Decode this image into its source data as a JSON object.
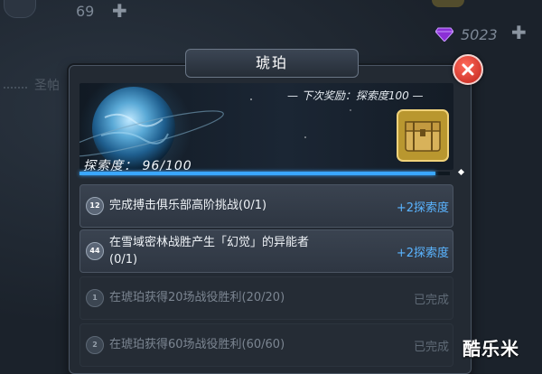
{
  "hud": {
    "left_count": "69",
    "gem_count": "5023",
    "plus_symbol": "✚"
  },
  "background_label": "圣帕",
  "dialog": {
    "title": "琥珀",
    "next_reward": "— 下次奖励：探索度100 —",
    "progress_label": "探索度：  96/100",
    "progress": {
      "current": 96,
      "max": 100
    },
    "tasks": [
      {
        "icon": "12",
        "text": "完成搏击俱乐部高阶挑战(0/1)",
        "reward": "+2探索度",
        "done": false
      },
      {
        "icon": "44",
        "text": "在雪域密林战胜产生「幻觉」的异能者",
        "text2": "(0/1)",
        "reward": "+2探索度",
        "done": false
      },
      {
        "icon": "1",
        "text": "在琥珀获得20场战役胜利(20/20)",
        "reward": "已完成",
        "done": true
      },
      {
        "icon": "2",
        "text": "在琥珀获得60场战役胜利(60/60)",
        "reward": "已完成",
        "done": true
      }
    ]
  },
  "watermark": "酷乐米",
  "colors": {
    "accent": "#3aa7ff",
    "reward": "#5ab4ff",
    "close": "#d8322a"
  }
}
